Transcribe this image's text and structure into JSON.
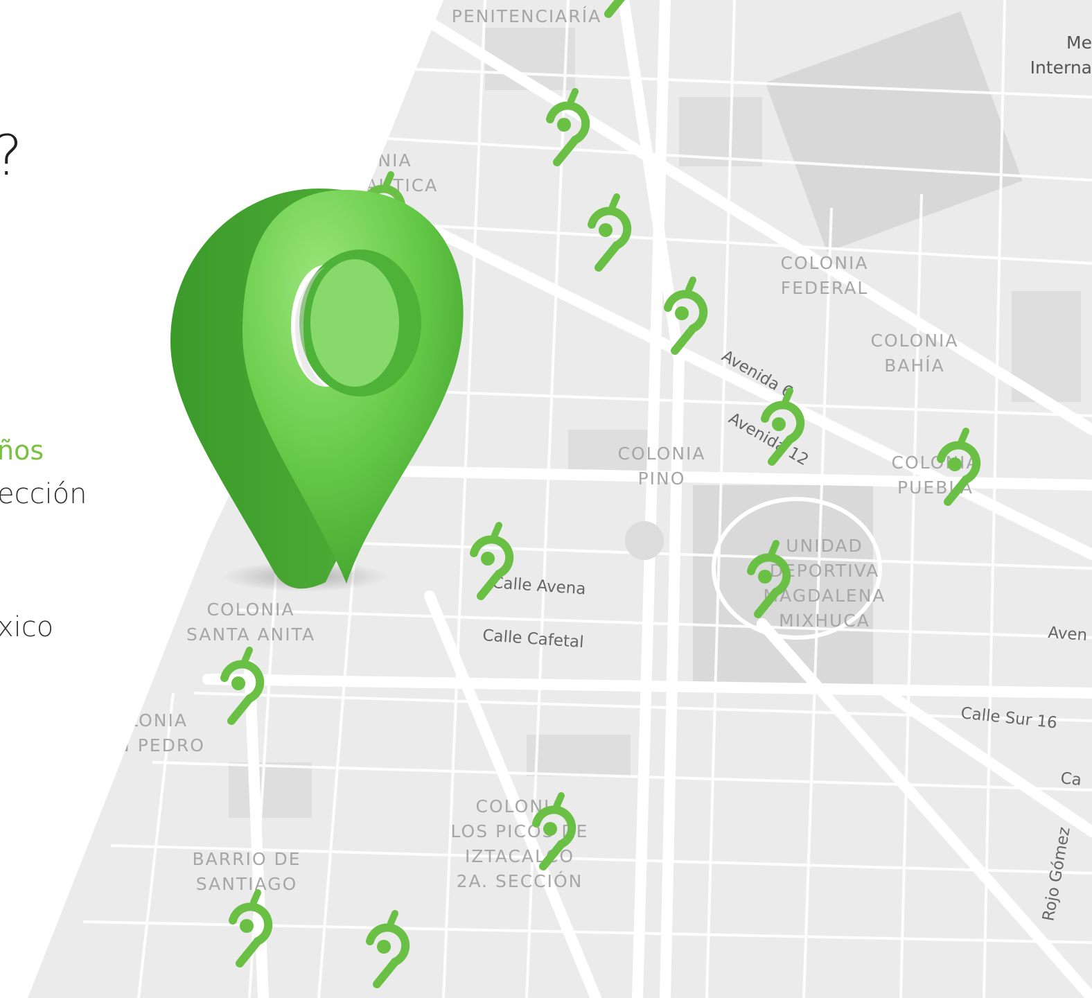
{
  "left_text": {
    "question_mark": "?",
    "green_fragment": "ños",
    "line_fragment": "ección",
    "city_fragment": "xico"
  },
  "colors": {
    "brand_green": "#7ac143",
    "marker_green": "#6ac045",
    "map_bg": "#ebebeb",
    "road": "#ffffff",
    "label_gray": "#a6a6a6"
  },
  "map": {
    "neighborhoods": [
      {
        "id": "penitenciaria",
        "lines": [
          "PENITENCIARÍA"
        ]
      },
      {
        "id": "aeronautica",
        "lines": [
          "NIA",
          "AUTICA"
        ]
      },
      {
        "id": "federal",
        "lines": [
          "COLONIA",
          "FEDERAL"
        ]
      },
      {
        "id": "bahia",
        "lines": [
          "COLONIA",
          "BAHÍA"
        ]
      },
      {
        "id": "pino",
        "lines": [
          "COLONIA",
          "PINO"
        ]
      },
      {
        "id": "puebla",
        "lines": [
          "COLONIA",
          "PUEBLA"
        ]
      },
      {
        "id": "deportiva",
        "lines": [
          "UNIDAD",
          "DEPORTIVA",
          "MAGDALENA",
          "MIXHUCA"
        ]
      },
      {
        "id": "santa-anita",
        "lines": [
          "COLONIA",
          "SANTA ANITA"
        ]
      },
      {
        "id": "san-pedro",
        "lines": [
          "LONIA",
          "N PEDRO"
        ]
      },
      {
        "id": "los-picos",
        "lines": [
          "COLONIA",
          "LOS PICOS DE",
          "IZTACALCO",
          "2A. SECCIÓN"
        ]
      },
      {
        "id": "santiago",
        "lines": [
          "BARRIO DE",
          "SANTIAGO"
        ]
      },
      {
        "id": "airport",
        "lines": [
          "Me",
          "Interna"
        ]
      }
    ],
    "streets": [
      {
        "id": "avenida-6",
        "name": "Avenida 6"
      },
      {
        "id": "avenida-12",
        "name": "Avenida 12"
      },
      {
        "id": "calle-avena",
        "name": "Calle Avena"
      },
      {
        "id": "calle-cafetal",
        "name": "Calle Cafetal"
      },
      {
        "id": "calle-sur-16",
        "name": "Calle Sur 16"
      },
      {
        "id": "rojo-gomez",
        "name": "Rojo Gómez"
      },
      {
        "id": "aven",
        "name": "Aven"
      },
      {
        "id": "ca",
        "name": "Ca"
      }
    ],
    "location_pins_count": 14
  }
}
